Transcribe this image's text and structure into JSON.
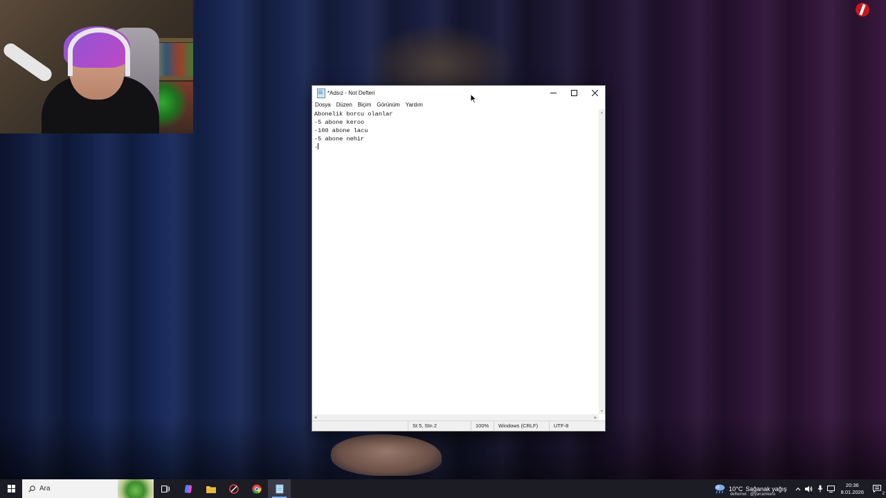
{
  "notepad": {
    "title": "*Adsız - Not Defteri",
    "menu": [
      "Dosya",
      "Düzen",
      "Biçim",
      "Görünüm",
      "Yardım"
    ],
    "lines": [
      "Abonelik borcu olanlar",
      "-5 abone keroo",
      "-100 abone lacu",
      "-5 abone nehir",
      "-"
    ],
    "status": {
      "position": "St 5, Stn 2",
      "zoom": "100%",
      "line_ending": "Windows (CRLF)",
      "encoding": "UTF-8"
    },
    "icons": {
      "minimize": "minimize-icon",
      "maximize": "maximize-icon",
      "close": "close-icon"
    }
  },
  "taskbar": {
    "search_placeholder": "Ara",
    "weather": {
      "temp": "10°C",
      "description": "Sağanak yağış",
      "subtext": "defternet : @yarramkero"
    },
    "clock": {
      "time": "20:36",
      "date": "8.01.2026"
    },
    "notification_count": "2",
    "pinned": [
      "start-icon",
      "task-view-icon",
      "copilot-icon",
      "file-explorer-icon",
      "app-icon",
      "chrome-icon",
      "notepad-icon"
    ],
    "accent_color": "#77b7f0"
  }
}
